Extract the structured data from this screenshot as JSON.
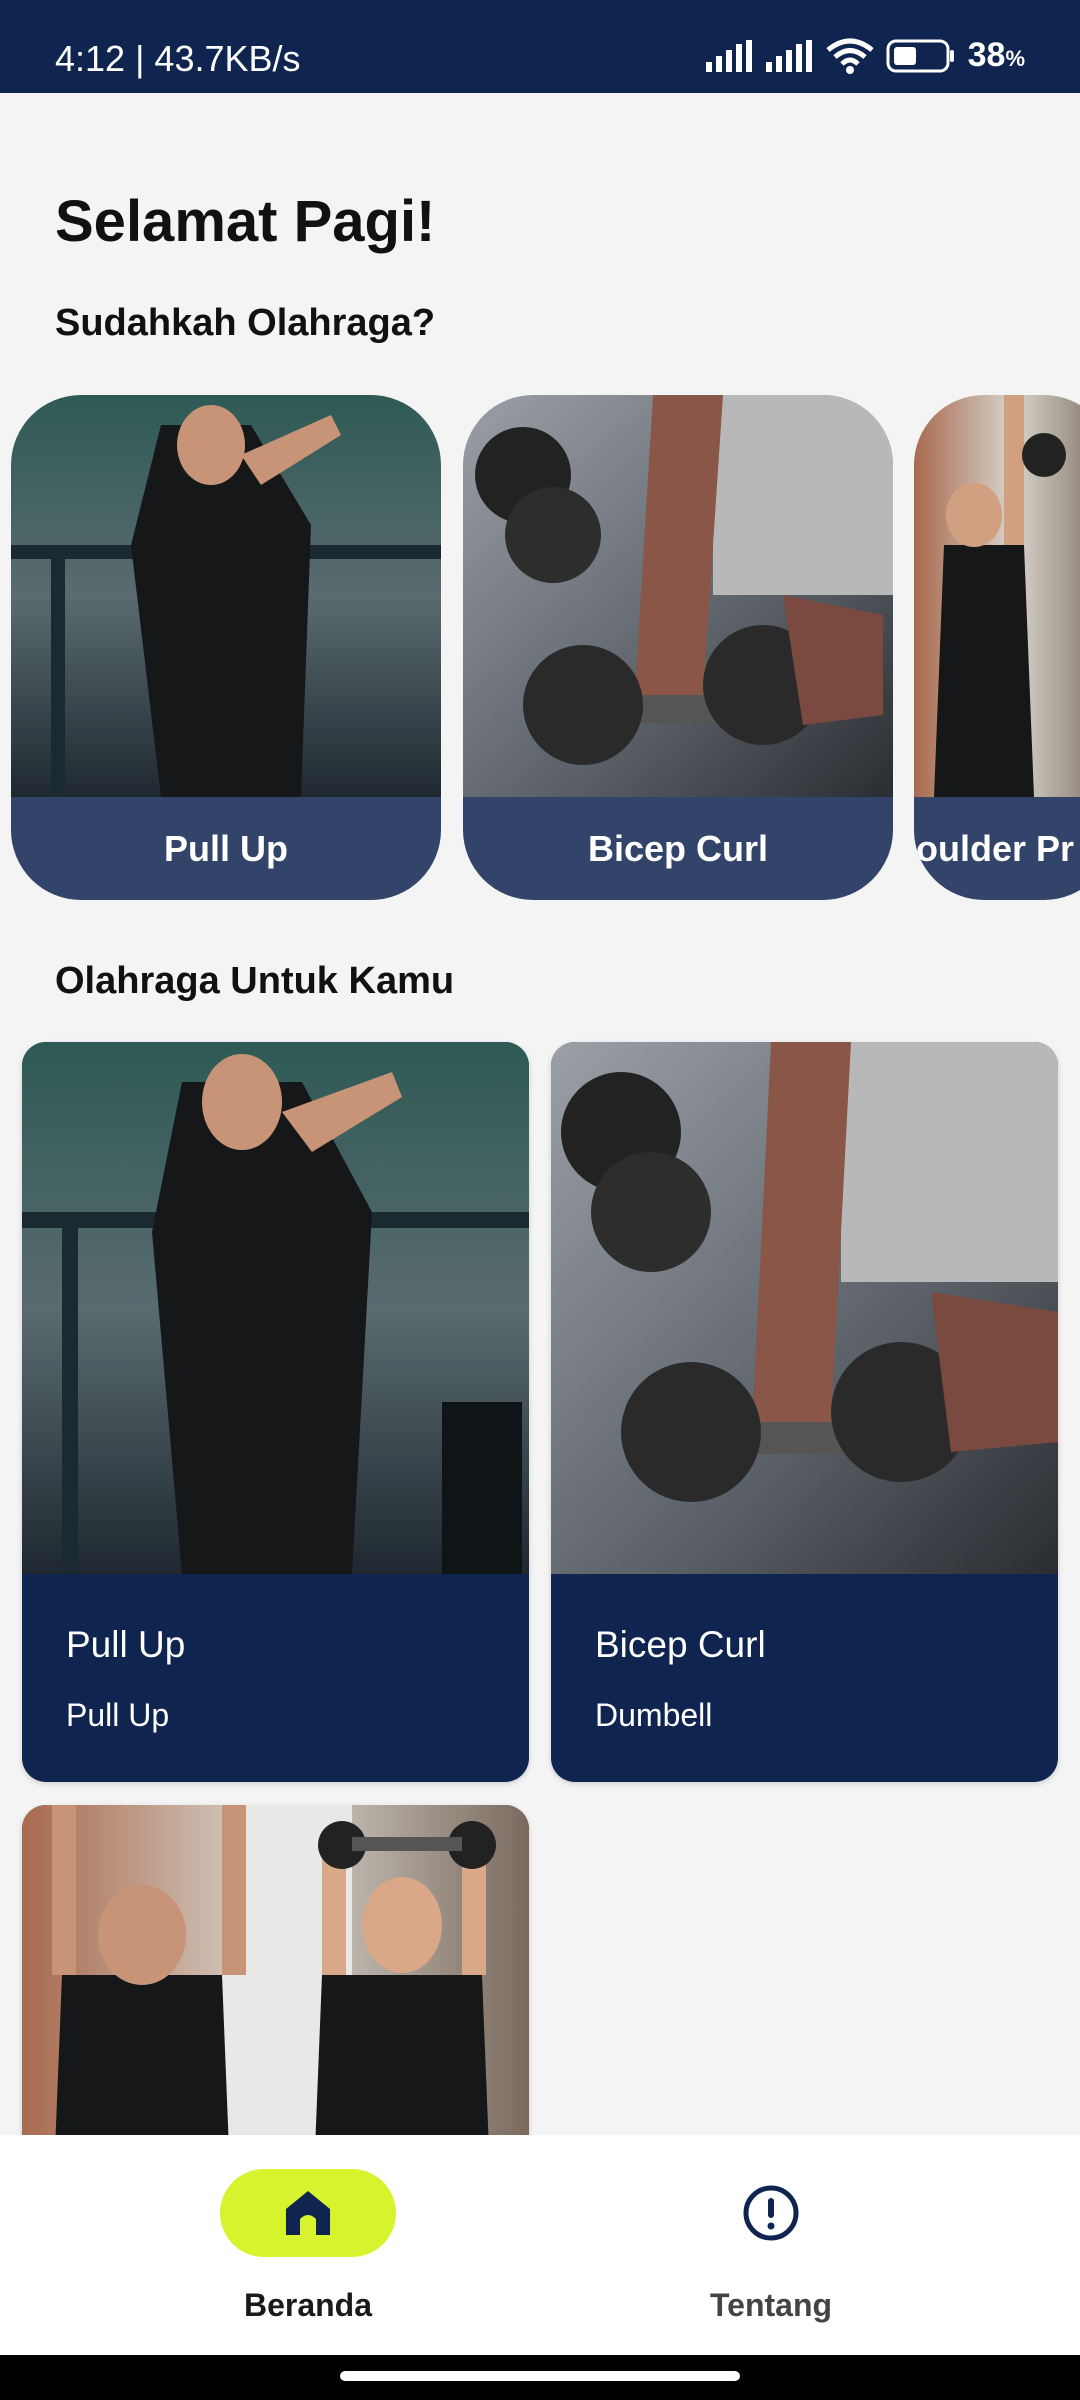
{
  "status_bar": {
    "time_speed": "4:12 | 43.7KB/s",
    "battery_percent": "38",
    "battery_unit": "%"
  },
  "header": {
    "greeting": "Selamat Pagi!",
    "subtitle": "Sudahkah Olahraga?"
  },
  "carousel": {
    "items": [
      {
        "label": "Pull Up",
        "image": "pull-up-photo"
      },
      {
        "label": "Bicep Curl",
        "image": "bicep-curl-photo"
      },
      {
        "label": "oulder Pr",
        "image": "shoulder-press-photo"
      }
    ]
  },
  "recommendations": {
    "title": "Olahraga Untuk Kamu",
    "items": [
      {
        "title": "Pull Up",
        "subtitle": "Pull Up",
        "image": "pull-up-photo"
      },
      {
        "title": "Bicep Curl",
        "subtitle": "Dumbell",
        "image": "bicep-curl-photo"
      },
      {
        "title": "",
        "subtitle": "",
        "image": "shoulder-press-photo"
      }
    ]
  },
  "bottom_nav": {
    "items": [
      {
        "label": "Beranda",
        "icon": "home-icon",
        "active": true
      },
      {
        "label": "Tentang",
        "icon": "info-icon",
        "active": false
      }
    ]
  },
  "colors": {
    "primary": "#0f2550",
    "accent": "#d7f32e",
    "background": "#f4f4f4"
  }
}
